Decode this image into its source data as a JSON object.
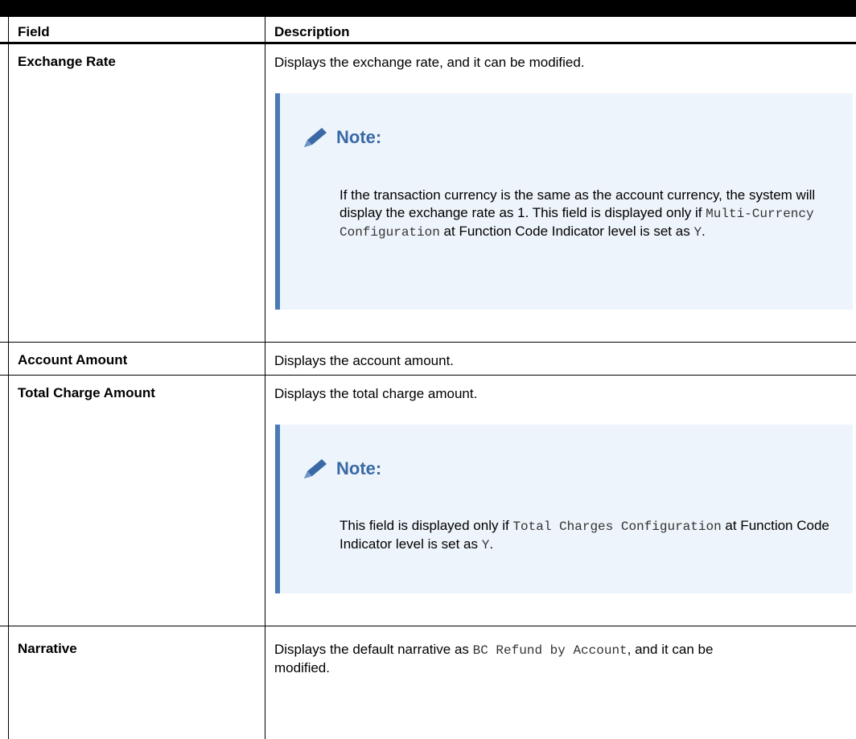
{
  "table": {
    "headers": {
      "field": "Field",
      "description": "Description"
    },
    "rows": [
      {
        "field": "Exchange Rate",
        "description": "Displays the exchange rate, and it can be modified.",
        "note": {
          "title": "Note:",
          "segments": [
            {
              "text": "If the transaction currency is the same as the account currency, the system will display the exchange rate as 1. This field is displayed only if ",
              "code": false
            },
            {
              "text": "Multi-Currency Configuration",
              "code": true
            },
            {
              "text": " at Function Code Indicator level is set as ",
              "code": false
            },
            {
              "text": "Y",
              "code": true
            },
            {
              "text": ".",
              "code": false
            }
          ]
        }
      },
      {
        "field": "Account Amount",
        "description": "Displays the account amount."
      },
      {
        "field": "Total Charge Amount",
        "description": "Displays the total charge amount.",
        "note": {
          "title": "Note:",
          "segments": [
            {
              "text": "This field is displayed only if ",
              "code": false
            },
            {
              "text": "Total Charges Configuration",
              "code": true
            },
            {
              "text": " at Function Code Indicator level is set as ",
              "code": false
            },
            {
              "text": "Y",
              "code": true
            },
            {
              "text": ".",
              "code": false
            }
          ]
        }
      },
      {
        "field": "Narrative",
        "description_segments": [
          {
            "text": "Displays the default narrative as ",
            "code": false
          },
          {
            "text": "BC Refund by Account",
            "code": true
          },
          {
            "text": ", and it can be modified.",
            "code": false
          }
        ]
      }
    ]
  },
  "colors": {
    "note_background": "#eef4fb",
    "note_accent": "#4a7ab8",
    "note_title": "#3a6aa6"
  },
  "icons": {
    "note_icon": "pencil-icon"
  }
}
